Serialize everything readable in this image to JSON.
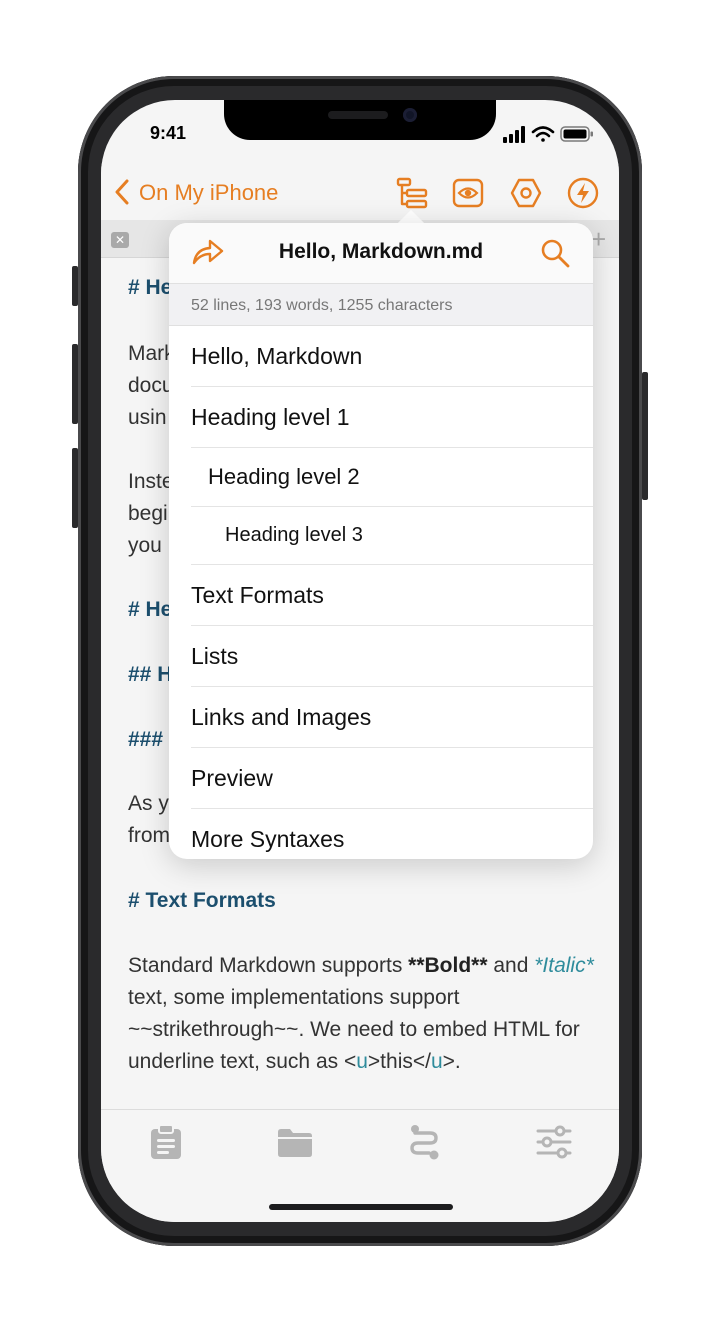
{
  "status": {
    "time": "9:41"
  },
  "navbar": {
    "back_label": "On My iPhone",
    "accent": "#e67e22",
    "icons": [
      "outline-icon",
      "preview-eye-icon",
      "hexagon-settings-icon",
      "bolt-icon"
    ]
  },
  "editor": {
    "peek_lines": [
      "# He",
      "Mark",
      "docu",
      "usin",
      "Inste",
      "begi",
      "you",
      "# He",
      "## H",
      "###",
      "As y",
      "from"
    ],
    "text_formats_heading": "# Text Formats",
    "paragraph": {
      "part1": "Standard Markdown supports ",
      "bold": "**Bold**",
      "part2": " and ",
      "italic": "*Italic*",
      "part3": " text, some implementations support ~~strikethrough~~. We need to embed HTML for underline text, such as <",
      "tag1": "u",
      "part4": ">this</",
      "tag2": "u",
      "part5": ">."
    },
    "heading_color": "#1c4f6e",
    "link_color": "#2f8c9c"
  },
  "popover": {
    "title": "Hello, Markdown.md",
    "stats": "52 lines, 193 words, 1255 characters",
    "outline": [
      {
        "label": "Hello, Markdown",
        "level": 1
      },
      {
        "label": "Heading level 1",
        "level": 1
      },
      {
        "label": "Heading level 2",
        "level": 2
      },
      {
        "label": "Heading level 3",
        "level": 3
      },
      {
        "label": "Text Formats",
        "level": 1
      },
      {
        "label": "Lists",
        "level": 1
      },
      {
        "label": "Links and Images",
        "level": 1
      },
      {
        "label": "Preview",
        "level": 1
      },
      {
        "label": "More Syntaxes",
        "level": 1
      }
    ]
  },
  "tabbar": {
    "icons": [
      "clipboard-icon",
      "folder-icon",
      "route-icon",
      "sliders-icon"
    ],
    "color": "#b5b5b5"
  }
}
